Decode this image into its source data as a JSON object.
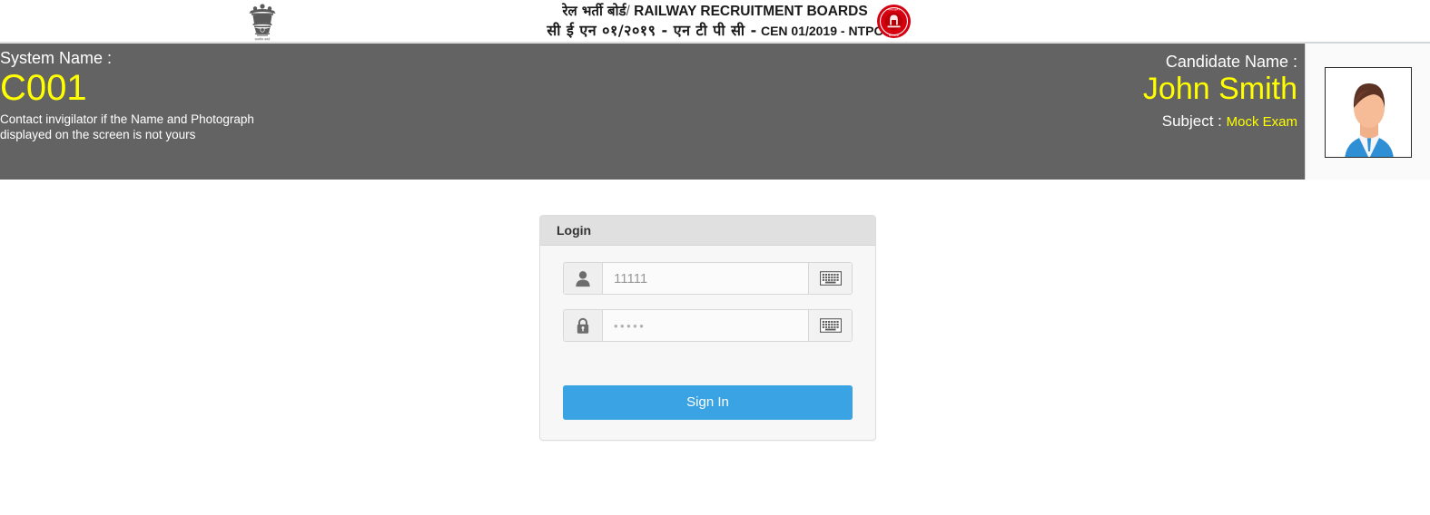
{
  "banner": {
    "hindi_title": "रेल भर्ती बोर्ड",
    "separator": "/",
    "english_title": "RAILWAY RECRUITMENT BOARDS",
    "hindi_cen": "सी ई एन ०१/२०१९  -  एन टी पी सी  -",
    "english_cen": "CEN 01/2019 - NTPC",
    "emblem_icon": "india-national-emblem-icon",
    "railway_logo_icon": "indian-railways-logo-icon"
  },
  "info_bar": {
    "system_name_label": "System Name :",
    "system_name_value": "C001",
    "note_line1": "Contact invigilator if the Name and Photograph",
    "note_line2": "displayed on the screen is not yours",
    "candidate_name_label": "Candidate Name :",
    "candidate_name_value": "John Smith",
    "subject_label": "Subject :",
    "subject_value": "Mock Exam",
    "photo_alt": "candidate-photograph",
    "bar_color": "#636363",
    "highlight_color": "#ffff00"
  },
  "login": {
    "panel_title": "Login",
    "username": {
      "value": "11111",
      "placeholder": "11111",
      "icon": "user-icon",
      "keyboard_icon": "virtual-keyboard-icon"
    },
    "password": {
      "value": "•••••",
      "placeholder": "•••••",
      "icon": "lock-icon",
      "keyboard_icon": "virtual-keyboard-icon"
    },
    "signin_label": "Sign In",
    "accent_color": "#3aa3e3"
  }
}
